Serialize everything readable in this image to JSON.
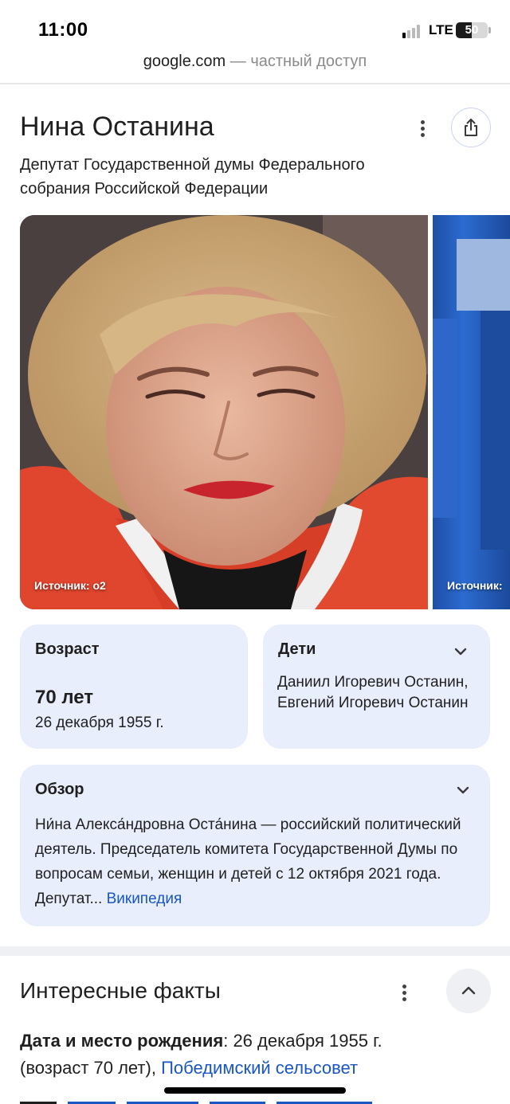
{
  "status_bar": {
    "time": "11:00",
    "network": "LTE",
    "battery_level": "50",
    "battery_fraction": 0.5,
    "signal_bars_active": 1
  },
  "url_bar": {
    "domain": "google.com",
    "separator": " — ",
    "mode": "частный доступ"
  },
  "knowledge_panel": {
    "title": "Нина Останина",
    "subtitle": "Депутат Государственной думы Федерального собрания Российской Федерации",
    "icons": {
      "more": "more-vert-icon",
      "share": "share-icon"
    },
    "images": [
      {
        "caption": "Источник: o2"
      },
      {
        "caption": "Источник:"
      }
    ],
    "age_card": {
      "label": "Возраст",
      "value": "70 лет",
      "date": "26 декабря 1955 г."
    },
    "children_card": {
      "label": "Дети",
      "value": "Даниил Игоревич Останин, Евгений Игоревич Останин"
    },
    "overview_card": {
      "label": "Обзор",
      "text": "Ни́на Алекса́ндровна Оста́нина — российский политический деятель. Председатель комитета Государственной Думы по вопросам семьи, женщин и детей с 12 октября 2021 года. Депутат",
      "ellipsis": "...",
      "source_link": "Википедия"
    }
  },
  "facts": {
    "title": "Интересные факты",
    "birth_label": "Дата и место рождения",
    "birth_colon": ": ",
    "birth_date": "26 декабря 1955 г.",
    "birth_age": "(возраст 70 лет), ",
    "birth_place_link": "Победимский сельсовет"
  },
  "colors": {
    "card_bg": "#e8eefc",
    "link": "#1a56c4",
    "text": "#1f1f1f"
  }
}
